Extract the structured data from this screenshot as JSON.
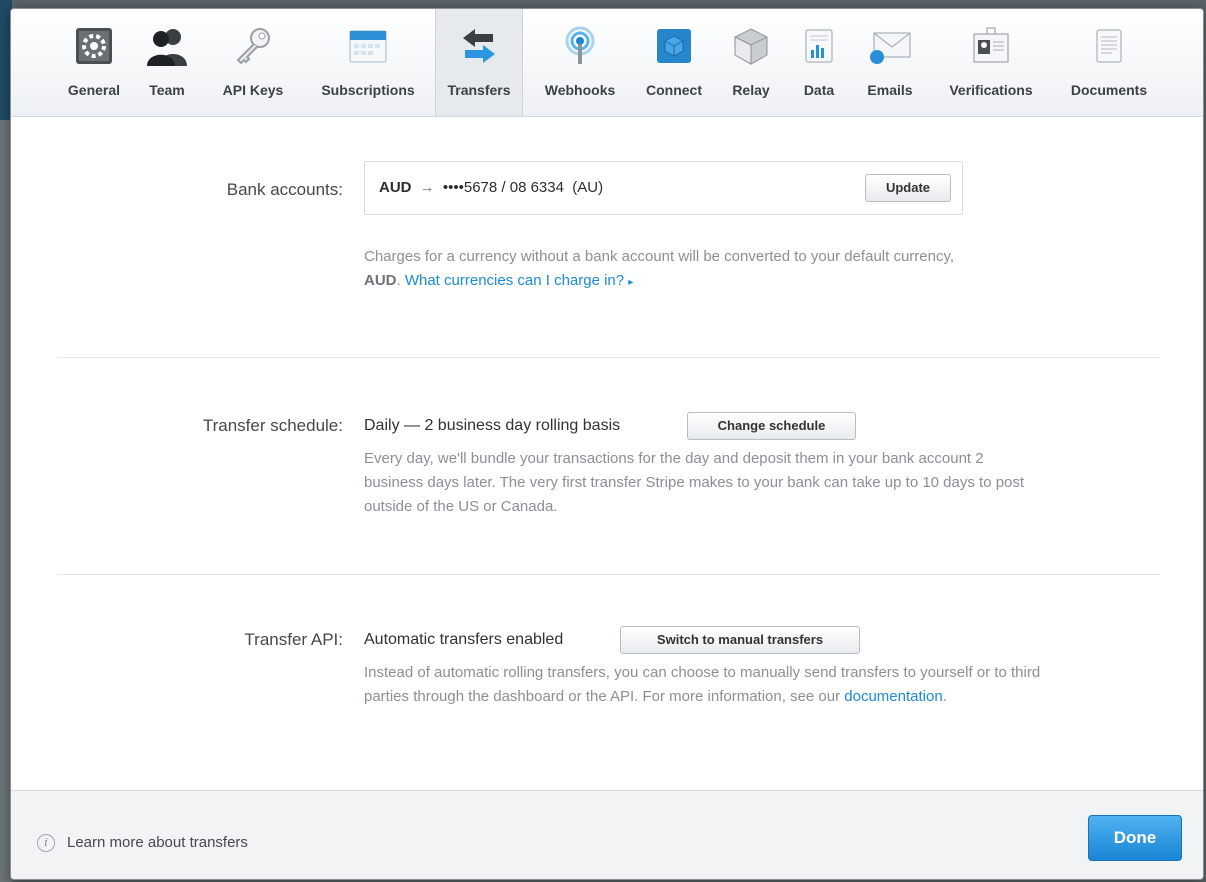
{
  "tabs": [
    {
      "label": "General",
      "icon": "gear-icon"
    },
    {
      "label": "Team",
      "icon": "team-icon"
    },
    {
      "label": "API Keys",
      "icon": "key-icon"
    },
    {
      "label": "Subscriptions",
      "icon": "calendar-icon"
    },
    {
      "label": "Transfers",
      "icon": "transfer-arrows-icon",
      "active": true
    },
    {
      "label": "Webhooks",
      "icon": "broadcast-icon"
    },
    {
      "label": "Connect",
      "icon": "cube-icon"
    },
    {
      "label": "Relay",
      "icon": "box-icon"
    },
    {
      "label": "Data",
      "icon": "chart-document-icon"
    },
    {
      "label": "Emails",
      "icon": "envelope-icon"
    },
    {
      "label": "Verifications",
      "icon": "id-card-icon"
    },
    {
      "label": "Documents",
      "icon": "document-icon"
    }
  ],
  "bank": {
    "label": "Bank accounts:",
    "currency": "AUD",
    "arrow": "→",
    "account": "••••5678 / 08 6334  (AU)",
    "update_button": "Update",
    "help_before": "Charges for a currency without a bank account will be converted to your default currency, ",
    "help_currency": "AUD",
    "help_after": ". ",
    "help_link": "What currencies can I charge in?",
    "help_link_arrow": "▸"
  },
  "schedule": {
    "label": "Transfer schedule:",
    "value": "Daily — 2 business day rolling basis",
    "button": "Change schedule",
    "help": "Every day, we'll bundle your transactions for the day and deposit them in your bank account 2 business days later. The very first transfer Stripe makes to your bank can take up to 10 days to post outside of the US or Canada."
  },
  "api": {
    "label": "Transfer API:",
    "value": "Automatic transfers enabled",
    "button": "Switch to manual transfers",
    "help_before": "Instead of automatic rolling transfers, you can choose to manually send transfers to yourself or to third parties through the dashboard or the API. For more information, see our ",
    "help_link": "documentation",
    "help_after": "."
  },
  "footer": {
    "info_symbol": "i",
    "learn_more": "Learn more about transfers",
    "done": "Done"
  },
  "colors": {
    "accent": "#1a8bd6",
    "done_button": "#2a95e0"
  }
}
